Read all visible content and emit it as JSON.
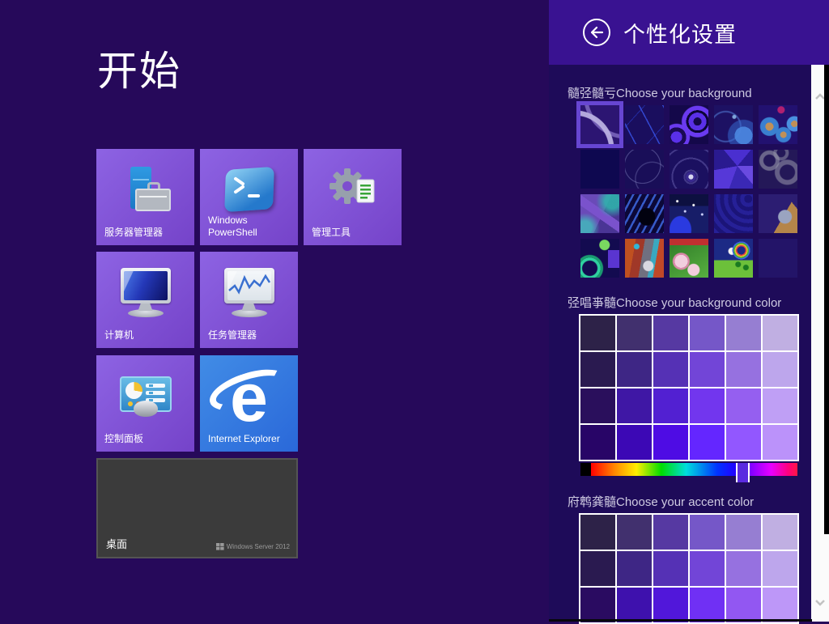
{
  "start": {
    "title": "开始",
    "tiles": [
      {
        "label": "服务器管理器"
      },
      {
        "label": "Windows PowerShell"
      },
      {
        "label": "管理工具"
      },
      {
        "label": "计算机"
      },
      {
        "label": "任务管理器"
      },
      {
        "label": "控制面板"
      },
      {
        "label": "Internet Explorer"
      }
    ],
    "desktop_tile": {
      "label": "桌面",
      "watermark": "Windows Server 2012"
    },
    "ie_letter": "e"
  },
  "panel": {
    "title": "个性化设置",
    "background": {
      "title": "髓弪髓亏Choose your background",
      "selected_index": 0,
      "thumbnails": [
        {
          "name": "background-thumbnail-ribbon-swirl",
          "cls": "th1",
          "selected": true
        },
        {
          "name": "background-thumbnail-crossing-lines",
          "cls": "th2"
        },
        {
          "name": "background-thumbnail-bold-swirls",
          "cls": "th3"
        },
        {
          "name": "background-thumbnail-flower-branch",
          "cls": "th4"
        },
        {
          "name": "background-thumbnail-lollipop-flowers",
          "cls": "th5"
        },
        {
          "name": "background-thumbnail-dunes",
          "cls": "th6"
        },
        {
          "name": "background-thumbnail-sketch-face",
          "cls": "th7"
        },
        {
          "name": "background-thumbnail-radial-dashes",
          "cls": "th8"
        },
        {
          "name": "background-thumbnail-crystals",
          "cls": "th9"
        },
        {
          "name": "background-thumbnail-gears",
          "cls": "th10"
        },
        {
          "name": "background-thumbnail-guitar",
          "cls": "th11"
        },
        {
          "name": "background-thumbnail-ferns",
          "cls": "th12"
        },
        {
          "name": "background-thumbnail-night-sky",
          "cls": "th13"
        },
        {
          "name": "background-thumbnail-concentric-rings",
          "cls": "th14"
        },
        {
          "name": "background-thumbnail-glider-bird",
          "cls": "th15"
        },
        {
          "name": "background-thumbnail-green-moon-swirl",
          "cls": "th16"
        },
        {
          "name": "background-thumbnail-abstract-collage",
          "cls": "th17"
        },
        {
          "name": "background-thumbnail-lilies",
          "cls": "th18"
        },
        {
          "name": "background-thumbnail-cartoon-meadow",
          "cls": "th19"
        },
        {
          "name": "background-thumbnail-solid-color",
          "cls": "th20"
        }
      ]
    },
    "background_color": {
      "title": "弪唱亊髓Choose your background color",
      "swatches": [
        "#2d2248",
        "#41306e",
        "#5639a2",
        "#7557c8",
        "#967ed2",
        "#c0afe2",
        "#2a1a50",
        "#3e2685",
        "#5531b5",
        "#7245d7",
        "#9671e0",
        "#bda6ec",
        "#2a0f5c",
        "#3f17a5",
        "#5220d2",
        "#7236ee",
        "#955ff0",
        "#bf9ff5",
        "#280567",
        "#3c08b5",
        "#4e0ce4",
        "#6426ff",
        "#9257ff",
        "#bb92fa"
      ],
      "hue_slider": {
        "handle_color": "#5b2be0",
        "position_pct": 72
      }
    },
    "accent_color": {
      "title": "府鹎龚髓Choose your accent color",
      "swatches": [
        "#2d2248",
        "#41306e",
        "#5639a2",
        "#7557c8",
        "#967ed2",
        "#c0afe2",
        "#2a1a50",
        "#3e2685",
        "#5531b5",
        "#7245d7",
        "#9671e0",
        "#bda6ec",
        "#2a0b61",
        "#3e11ad",
        "#5117da",
        "#7030f4",
        "#9257f2",
        "#bd97f8"
      ]
    }
  },
  "colors": {
    "header": "#391291",
    "panel_bg": "#1e0b59",
    "start_bg": "#26095a",
    "tile": "#8055d6",
    "ie_tile": "#2f74dd",
    "selection": "#6746d2"
  }
}
